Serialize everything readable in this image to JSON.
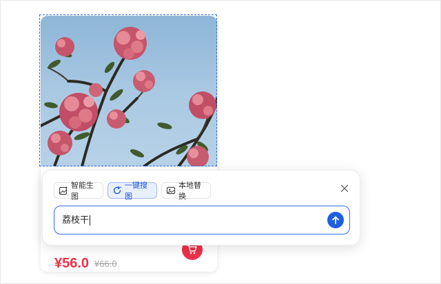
{
  "product": {
    "price_current": "¥56.0",
    "price_original": "¥66.0",
    "image_icon": "flower-photo",
    "cart_icon": "cart-icon"
  },
  "popup": {
    "tabs": [
      {
        "label": "智能生图",
        "icon": "image-sparkle-icon",
        "active": false
      },
      {
        "label": "一键搜图",
        "icon": "refresh-search-icon",
        "active": true
      },
      {
        "label": "本地替换",
        "icon": "image-replace-icon",
        "active": false
      }
    ],
    "input_value": "荔枝干",
    "close_icon": "close-icon",
    "send_icon": "arrow-up-icon"
  },
  "colors": {
    "accent": "#1f5fe0",
    "price": "#f0304a",
    "tab_active_bg": "#e8f0ff"
  }
}
